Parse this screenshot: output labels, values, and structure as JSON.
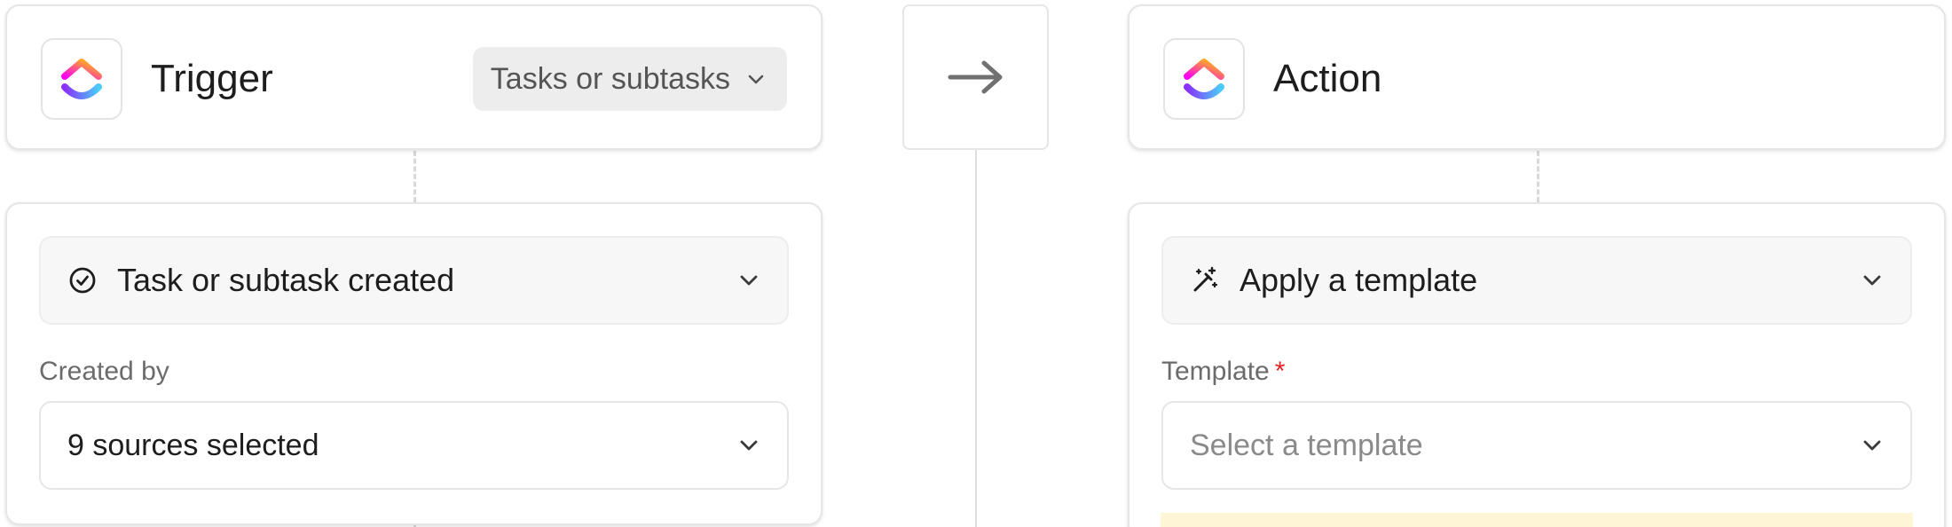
{
  "trigger": {
    "title": "Trigger",
    "scope_dropdown": "Tasks or subtasks",
    "event": "Task or subtask created",
    "created_by_label": "Created by",
    "created_by_value": "9 sources selected"
  },
  "action": {
    "title": "Action",
    "event": "Apply a template",
    "template_label": "Template",
    "required_marker": "*",
    "template_placeholder": "Select a template"
  },
  "icons": {
    "app_logo": "clickup-logo-icon",
    "arrow": "arrow-right-icon",
    "check": "check-circle-icon",
    "wand": "magic-wand-icon",
    "chevron": "chevron-down-icon"
  },
  "colors": {
    "logo_gradient": [
      "#fd71af",
      "#8930fd",
      "#49ccf9",
      "#ffc800"
    ],
    "required": "#e02424",
    "banner": "#fdf5d6"
  }
}
